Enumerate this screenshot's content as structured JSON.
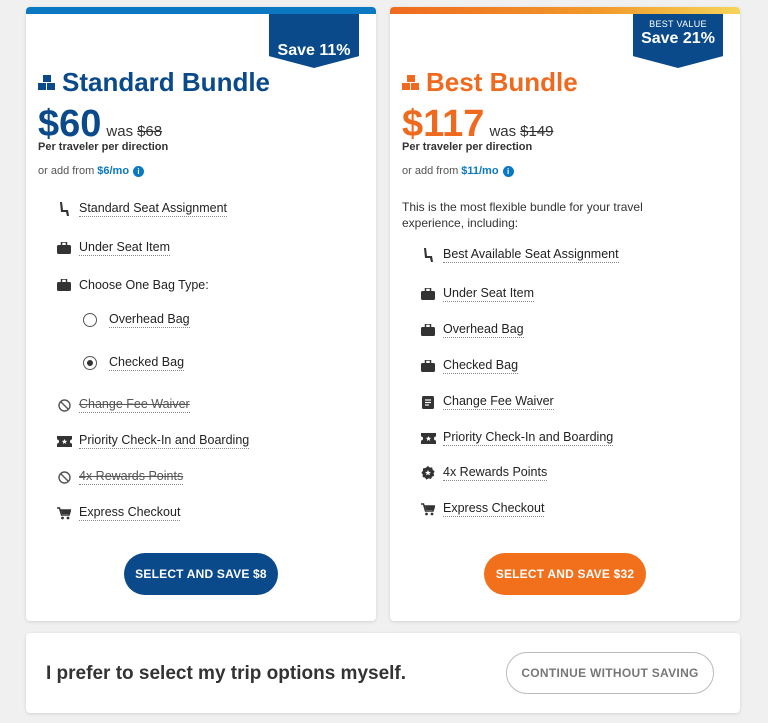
{
  "standard": {
    "ribbon_small": "",
    "ribbon_big": "Save 11%",
    "title": "Standard Bundle",
    "price": "$60",
    "was_label": "was",
    "old_price": "$68",
    "per_traveler": "Per traveler per direction",
    "add_from_prefix": "or add from",
    "add_from_price": "$6/mo",
    "features": {
      "seat": "Standard Seat Assignment",
      "under_seat": "Under Seat Item",
      "bag_type": "Choose One Bag Type:",
      "overhead": "Overhead Bag",
      "checked": "Checked Bag",
      "change_fee": "Change Fee Waiver",
      "priority": "Priority Check-In and Boarding",
      "rewards": "4x Rewards Points",
      "express": "Express Checkout"
    },
    "selected_bag": "Checked Bag",
    "select_button": "SELECT AND SAVE $8"
  },
  "best": {
    "ribbon_small": "BEST VALUE",
    "ribbon_big": "Save 21%",
    "title": "Best Bundle",
    "price": "$117",
    "was_label": "was",
    "old_price": "$149",
    "per_traveler": "Per traveler per direction",
    "add_from_prefix": "or add from",
    "add_from_price": "$11/mo",
    "description": "This is the most flexible bundle for your travel experience, including:",
    "features": {
      "seat": "Best Available Seat Assignment",
      "under_seat": "Under Seat Item",
      "overhead": "Overhead Bag",
      "checked": "Checked Bag",
      "change_fee": "Change Fee Waiver",
      "priority": "Priority Check-In and Boarding",
      "rewards": "4x Rewards Points",
      "express": "Express Checkout"
    },
    "select_button": "SELECT AND SAVE $32"
  },
  "bottom": {
    "prefer_text": "I prefer to select my trip options myself.",
    "continue_button": "CONTINUE WITHOUT SAVING"
  },
  "colors": {
    "standard_accent": "#0a4a8a",
    "best_accent": "#ef6a1f",
    "link": "#0a78c2"
  }
}
